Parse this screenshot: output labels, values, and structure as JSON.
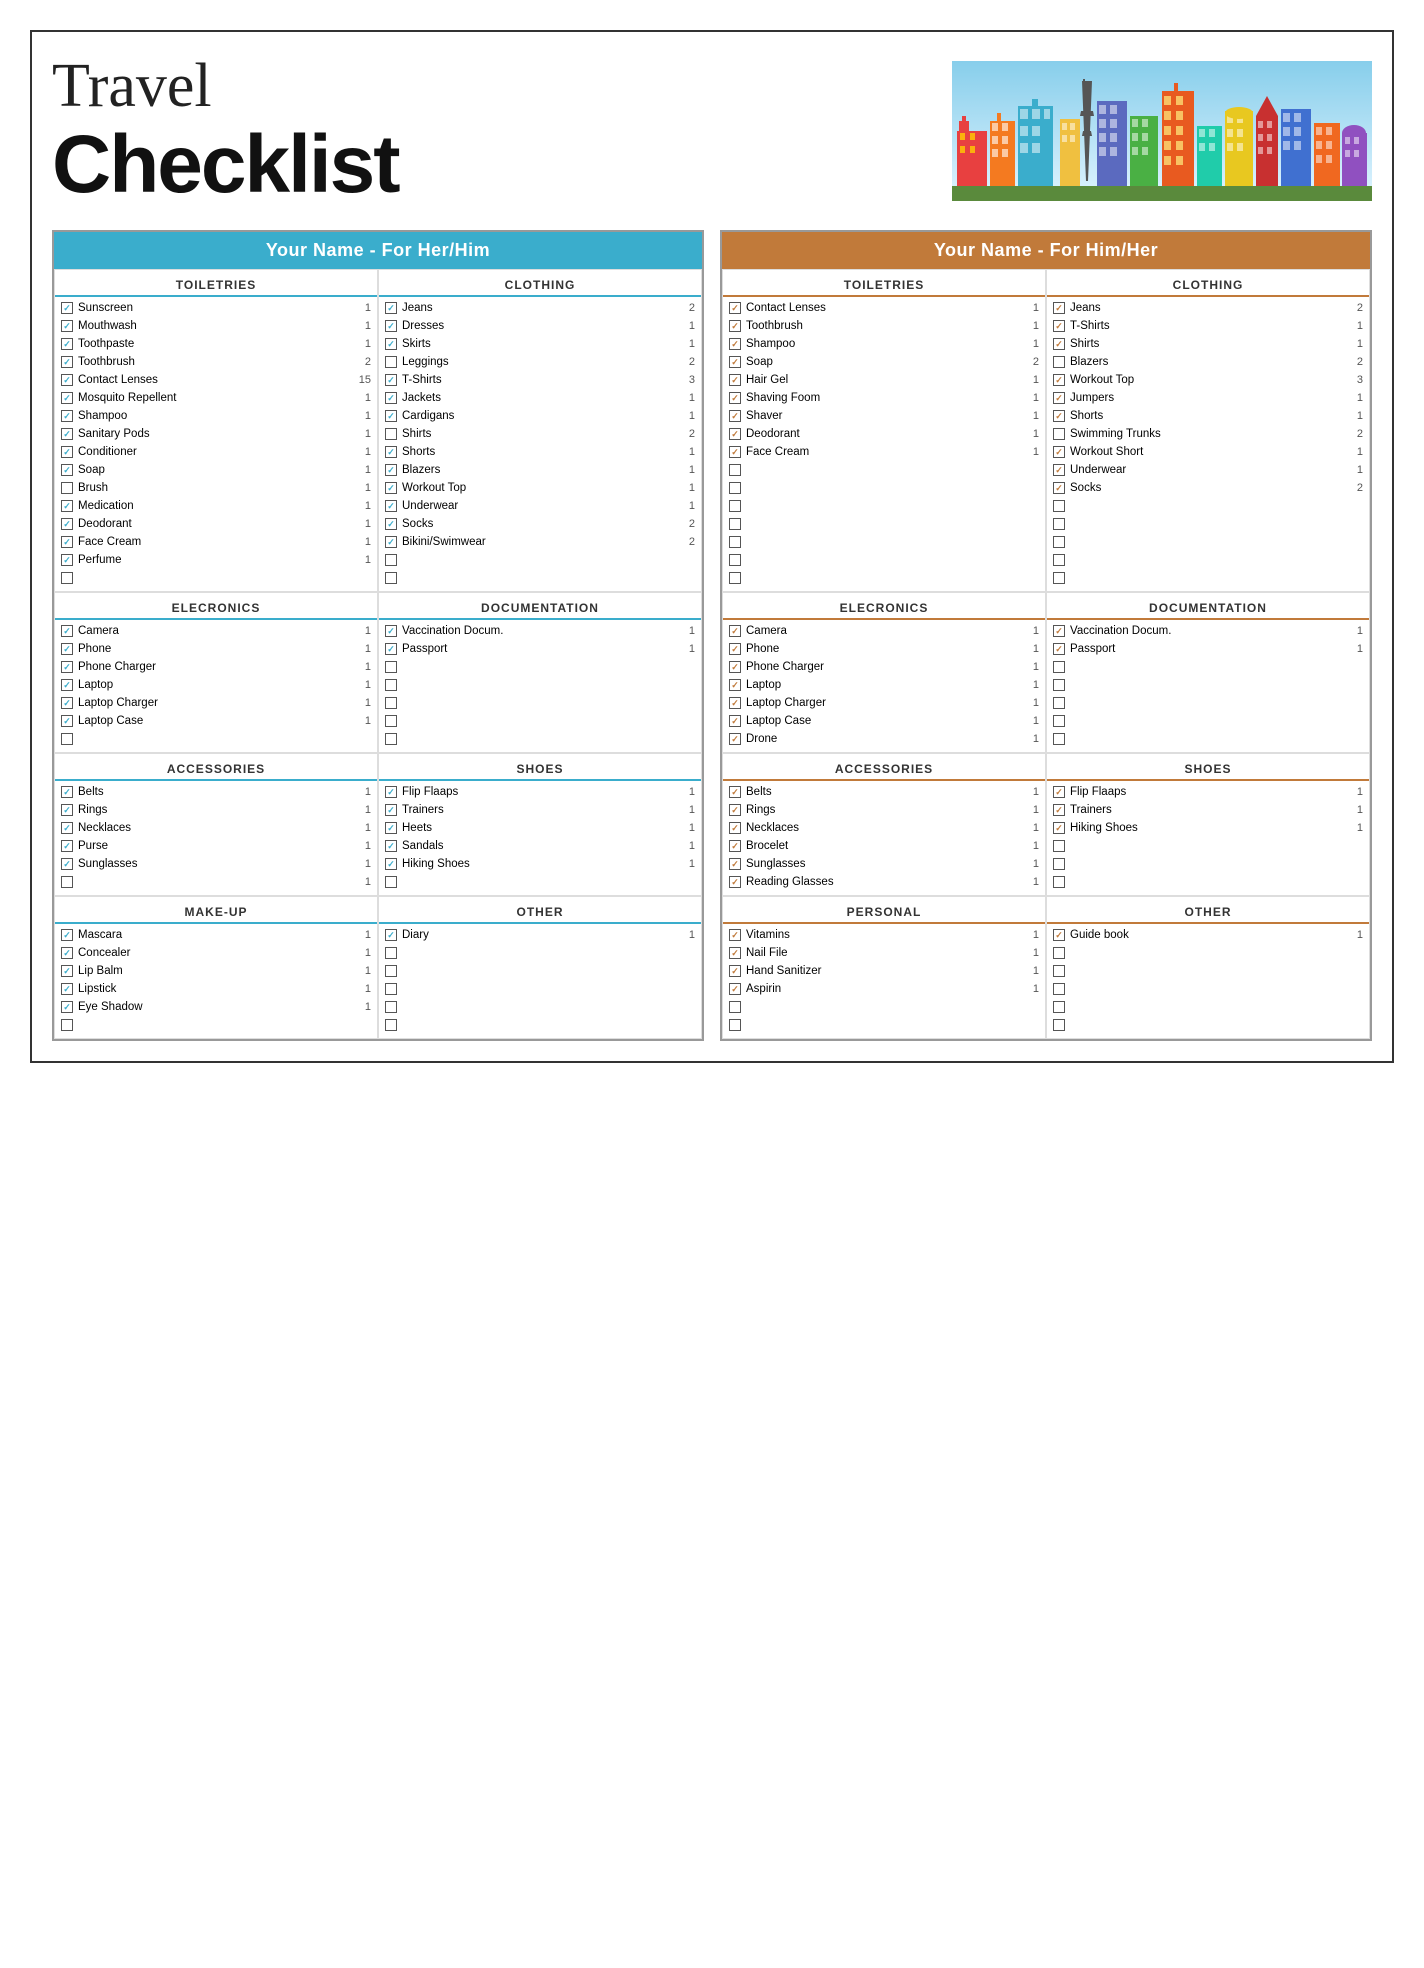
{
  "header": {
    "title_travel": "Travel",
    "title_checklist": "Checklist"
  },
  "her": {
    "column_label": "Your Name - For Her/Him",
    "toiletries": {
      "title": "TOILETRIES",
      "items": [
        {
          "checked": true,
          "name": "Sunscreen",
          "qty": 1
        },
        {
          "checked": true,
          "name": "Mouthwash",
          "qty": 1
        },
        {
          "checked": true,
          "name": "Toothpaste",
          "qty": 1
        },
        {
          "checked": true,
          "name": "Toothbrush",
          "qty": 2
        },
        {
          "checked": true,
          "name": "Contact Lenses",
          "qty": 15
        },
        {
          "checked": true,
          "name": "Mosquito Repellent",
          "qty": 1
        },
        {
          "checked": true,
          "name": "Shampoo",
          "qty": 1
        },
        {
          "checked": true,
          "name": "Sanitary Pods",
          "qty": 1
        },
        {
          "checked": true,
          "name": "Conditioner",
          "qty": 1
        },
        {
          "checked": true,
          "name": "Soap",
          "qty": 1
        },
        {
          "checked": false,
          "name": "Brush",
          "qty": 1
        },
        {
          "checked": true,
          "name": "Medication",
          "qty": 1
        },
        {
          "checked": true,
          "name": "Deodorant",
          "qty": 1
        },
        {
          "checked": true,
          "name": "Face Cream",
          "qty": 1
        },
        {
          "checked": true,
          "name": "Perfume",
          "qty": 1
        },
        {
          "checked": false,
          "name": "",
          "qty": ""
        }
      ]
    },
    "clothing": {
      "title": "CLOTHING",
      "items": [
        {
          "checked": true,
          "name": "Jeans",
          "qty": 2
        },
        {
          "checked": true,
          "name": "Dresses",
          "qty": 1
        },
        {
          "checked": true,
          "name": "Skirts",
          "qty": 1
        },
        {
          "checked": false,
          "name": "Leggings",
          "qty": 2
        },
        {
          "checked": true,
          "name": "T-Shirts",
          "qty": 3
        },
        {
          "checked": true,
          "name": "Jackets",
          "qty": 1
        },
        {
          "checked": true,
          "name": "Cardigans",
          "qty": 1
        },
        {
          "checked": false,
          "name": "Shirts",
          "qty": 2
        },
        {
          "checked": true,
          "name": "Shorts",
          "qty": 1
        },
        {
          "checked": true,
          "name": "Blazers",
          "qty": 1
        },
        {
          "checked": true,
          "name": "Workout Top",
          "qty": 1
        },
        {
          "checked": true,
          "name": "Underwear",
          "qty": 1
        },
        {
          "checked": true,
          "name": "Socks",
          "qty": 2
        },
        {
          "checked": true,
          "name": "Bikini/Swimwear",
          "qty": 2
        },
        {
          "checked": false,
          "name": "",
          "qty": ""
        },
        {
          "checked": false,
          "name": "",
          "qty": ""
        }
      ]
    },
    "electronics": {
      "title": "ELECRONICS",
      "items": [
        {
          "checked": true,
          "name": "Camera",
          "qty": 1
        },
        {
          "checked": true,
          "name": "Phone",
          "qty": 1
        },
        {
          "checked": true,
          "name": "Phone Charger",
          "qty": 1
        },
        {
          "checked": true,
          "name": "Laptop",
          "qty": 1
        },
        {
          "checked": true,
          "name": "Laptop Charger",
          "qty": 1
        },
        {
          "checked": true,
          "name": "Laptop Case",
          "qty": 1
        },
        {
          "checked": false,
          "name": "",
          "qty": ""
        }
      ]
    },
    "documentation": {
      "title": "DOCUMENTATION",
      "items": [
        {
          "checked": true,
          "name": "Vaccination Docum.",
          "qty": 1
        },
        {
          "checked": true,
          "name": "Passport",
          "qty": 1
        },
        {
          "checked": false,
          "name": "",
          "qty": ""
        },
        {
          "checked": false,
          "name": "",
          "qty": ""
        },
        {
          "checked": false,
          "name": "",
          "qty": ""
        },
        {
          "checked": false,
          "name": "",
          "qty": ""
        },
        {
          "checked": false,
          "name": "",
          "qty": ""
        }
      ]
    },
    "accessories": {
      "title": "ACCESSORIES",
      "items": [
        {
          "checked": true,
          "name": "Belts",
          "qty": 1
        },
        {
          "checked": true,
          "name": "Rings",
          "qty": 1
        },
        {
          "checked": true,
          "name": "Necklaces",
          "qty": 1
        },
        {
          "checked": true,
          "name": "Purse",
          "qty": 1
        },
        {
          "checked": true,
          "name": "Sunglasses",
          "qty": 1
        },
        {
          "checked": false,
          "name": "",
          "qty": 1
        }
      ]
    },
    "shoes": {
      "title": "SHOES",
      "items": [
        {
          "checked": true,
          "name": "Flip Flaaps",
          "qty": 1
        },
        {
          "checked": true,
          "name": "Trainers",
          "qty": 1
        },
        {
          "checked": true,
          "name": "Heets",
          "qty": 1
        },
        {
          "checked": true,
          "name": "Sandals",
          "qty": 1
        },
        {
          "checked": true,
          "name": "Hiking Shoes",
          "qty": 1
        },
        {
          "checked": false,
          "name": "",
          "qty": ""
        }
      ]
    },
    "makeup": {
      "title": "MAKE-UP",
      "items": [
        {
          "checked": true,
          "name": "Mascara",
          "qty": 1
        },
        {
          "checked": true,
          "name": "Concealer",
          "qty": 1
        },
        {
          "checked": true,
          "name": "Lip Balm",
          "qty": 1
        },
        {
          "checked": true,
          "name": "Lipstick",
          "qty": 1
        },
        {
          "checked": true,
          "name": "Eye Shadow",
          "qty": 1
        },
        {
          "checked": false,
          "name": "",
          "qty": ""
        }
      ]
    },
    "other": {
      "title": "OTHER",
      "items": [
        {
          "checked": true,
          "name": "Diary",
          "qty": 1
        },
        {
          "checked": false,
          "name": "",
          "qty": ""
        },
        {
          "checked": false,
          "name": "",
          "qty": ""
        },
        {
          "checked": false,
          "name": "",
          "qty": ""
        },
        {
          "checked": false,
          "name": "",
          "qty": ""
        },
        {
          "checked": false,
          "name": "",
          "qty": ""
        }
      ]
    }
  },
  "him": {
    "column_label": "Your Name - For Him/Her",
    "toiletries": {
      "title": "TOILETRIES",
      "items": [
        {
          "checked": true,
          "name": "Contact Lenses",
          "qty": 1
        },
        {
          "checked": true,
          "name": "Toothbrush",
          "qty": 1
        },
        {
          "checked": true,
          "name": "Shampoo",
          "qty": 1
        },
        {
          "checked": true,
          "name": "Soap",
          "qty": 2
        },
        {
          "checked": true,
          "name": "Hair Gel",
          "qty": 1
        },
        {
          "checked": true,
          "name": "Shaving Foom",
          "qty": 1
        },
        {
          "checked": true,
          "name": "Shaver",
          "qty": 1
        },
        {
          "checked": true,
          "name": "Deodorant",
          "qty": 1
        },
        {
          "checked": true,
          "name": "Face Cream",
          "qty": 1
        },
        {
          "checked": false,
          "name": "",
          "qty": ""
        },
        {
          "checked": false,
          "name": "",
          "qty": ""
        },
        {
          "checked": false,
          "name": "",
          "qty": ""
        },
        {
          "checked": false,
          "name": "",
          "qty": ""
        },
        {
          "checked": false,
          "name": "",
          "qty": ""
        },
        {
          "checked": false,
          "name": "",
          "qty": ""
        },
        {
          "checked": false,
          "name": "",
          "qty": ""
        }
      ]
    },
    "clothing": {
      "title": "CLOTHING",
      "items": [
        {
          "checked": true,
          "name": "Jeans",
          "qty": 2
        },
        {
          "checked": true,
          "name": "T-Shirts",
          "qty": 1
        },
        {
          "checked": true,
          "name": "Shirts",
          "qty": 1
        },
        {
          "checked": false,
          "name": "Blazers",
          "qty": 2
        },
        {
          "checked": true,
          "name": "Workout Top",
          "qty": 3
        },
        {
          "checked": true,
          "name": "Jumpers",
          "qty": 1
        },
        {
          "checked": true,
          "name": "Shorts",
          "qty": 1
        },
        {
          "checked": false,
          "name": "Swimming Trunks",
          "qty": 2
        },
        {
          "checked": true,
          "name": "Workout Short",
          "qty": 1
        },
        {
          "checked": true,
          "name": "Underwear",
          "qty": 1
        },
        {
          "checked": true,
          "name": "Socks",
          "qty": 2
        },
        {
          "checked": false,
          "name": "",
          "qty": ""
        },
        {
          "checked": false,
          "name": "",
          "qty": ""
        },
        {
          "checked": false,
          "name": "",
          "qty": ""
        },
        {
          "checked": false,
          "name": "",
          "qty": ""
        },
        {
          "checked": false,
          "name": "",
          "qty": ""
        }
      ]
    },
    "electronics": {
      "title": "ELECRONICS",
      "items": [
        {
          "checked": true,
          "name": "Camera",
          "qty": 1
        },
        {
          "checked": true,
          "name": "Phone",
          "qty": 1
        },
        {
          "checked": true,
          "name": "Phone Charger",
          "qty": 1
        },
        {
          "checked": true,
          "name": "Laptop",
          "qty": 1
        },
        {
          "checked": true,
          "name": "Laptop Charger",
          "qty": 1
        },
        {
          "checked": true,
          "name": "Laptop Case",
          "qty": 1
        },
        {
          "checked": true,
          "name": "Drone",
          "qty": 1
        }
      ]
    },
    "documentation": {
      "title": "DOCUMENTATION",
      "items": [
        {
          "checked": true,
          "name": "Vaccination Docum.",
          "qty": 1
        },
        {
          "checked": true,
          "name": "Passport",
          "qty": 1
        },
        {
          "checked": false,
          "name": "",
          "qty": ""
        },
        {
          "checked": false,
          "name": "",
          "qty": ""
        },
        {
          "checked": false,
          "name": "",
          "qty": ""
        },
        {
          "checked": false,
          "name": "",
          "qty": ""
        },
        {
          "checked": false,
          "name": "",
          "qty": ""
        }
      ]
    },
    "accessories": {
      "title": "ACCESSORIES",
      "items": [
        {
          "checked": true,
          "name": "Belts",
          "qty": 1
        },
        {
          "checked": true,
          "name": "Rings",
          "qty": 1
        },
        {
          "checked": true,
          "name": "Necklaces",
          "qty": 1
        },
        {
          "checked": true,
          "name": "Brocelet",
          "qty": 1
        },
        {
          "checked": true,
          "name": "Sunglasses",
          "qty": 1
        },
        {
          "checked": true,
          "name": "Reading Glasses",
          "qty": 1
        }
      ]
    },
    "shoes": {
      "title": "SHOES",
      "items": [
        {
          "checked": true,
          "name": "Flip Flaaps",
          "qty": 1
        },
        {
          "checked": true,
          "name": "Trainers",
          "qty": 1
        },
        {
          "checked": true,
          "name": "Hiking Shoes",
          "qty": 1
        },
        {
          "checked": false,
          "name": "",
          "qty": ""
        },
        {
          "checked": false,
          "name": "",
          "qty": ""
        },
        {
          "checked": false,
          "name": "",
          "qty": ""
        }
      ]
    },
    "personal": {
      "title": "PERSONAL",
      "items": [
        {
          "checked": true,
          "name": "Vitamins",
          "qty": 1
        },
        {
          "checked": true,
          "name": "Nail File",
          "qty": 1
        },
        {
          "checked": true,
          "name": "Hand Sanitizer",
          "qty": 1
        },
        {
          "checked": true,
          "name": "Aspirin",
          "qty": 1
        },
        {
          "checked": false,
          "name": "",
          "qty": ""
        },
        {
          "checked": false,
          "name": "",
          "qty": ""
        }
      ]
    },
    "other": {
      "title": "OTHER",
      "items": [
        {
          "checked": true,
          "name": "Guide book",
          "qty": 1
        },
        {
          "checked": false,
          "name": "",
          "qty": ""
        },
        {
          "checked": false,
          "name": "",
          "qty": ""
        },
        {
          "checked": false,
          "name": "",
          "qty": ""
        },
        {
          "checked": false,
          "name": "",
          "qty": ""
        },
        {
          "checked": false,
          "name": "",
          "qty": ""
        }
      ]
    }
  }
}
